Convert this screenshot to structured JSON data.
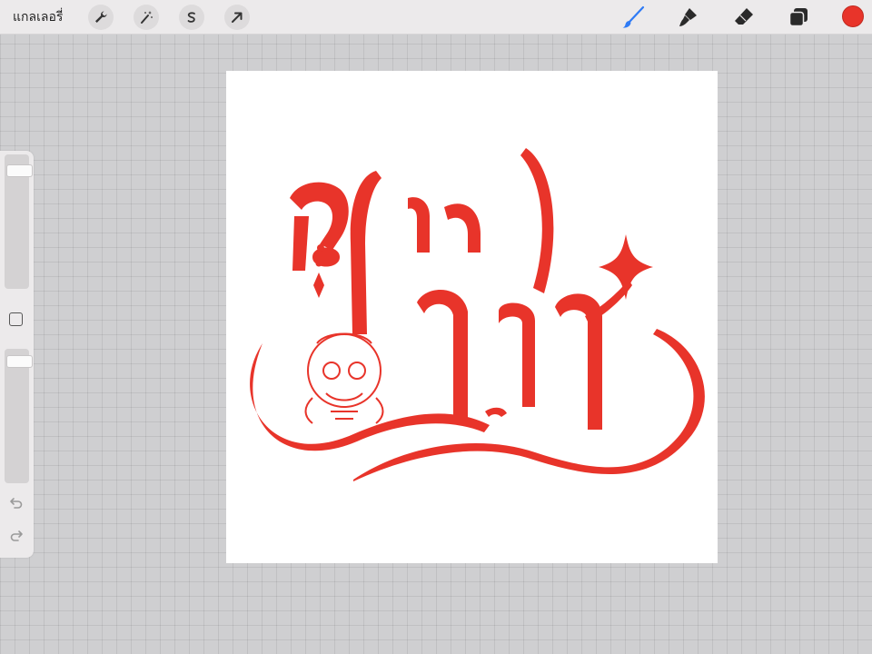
{
  "topbar": {
    "gallery_label": "แกลเลอรี่",
    "left_tools": [
      {
        "name": "actions",
        "icon": "wrench-icon"
      },
      {
        "name": "adjustments",
        "icon": "magic-wand-icon"
      },
      {
        "name": "selection",
        "icon": "selection-s-icon"
      },
      {
        "name": "transform",
        "icon": "arrow-cursor-icon"
      }
    ],
    "right_tools": [
      {
        "name": "brush",
        "icon": "brush-icon",
        "active": true
      },
      {
        "name": "smudge",
        "icon": "smudge-icon"
      },
      {
        "name": "eraser",
        "icon": "eraser-icon"
      },
      {
        "name": "layers",
        "icon": "layers-icon"
      }
    ],
    "current_color": "#e8342a",
    "active_tool_color": "#2f7bf5"
  },
  "sidebar": {
    "brush_size_level": 0.08,
    "opacity_level": 0.05,
    "tools": [
      "modify-square-icon",
      "undo-icon",
      "redo-icon"
    ]
  },
  "canvas": {
    "background": "#ffffff",
    "artwork": {
      "description_icon": "thai-lettering-dragon-artwork",
      "ink_color": "#e8342a"
    }
  }
}
